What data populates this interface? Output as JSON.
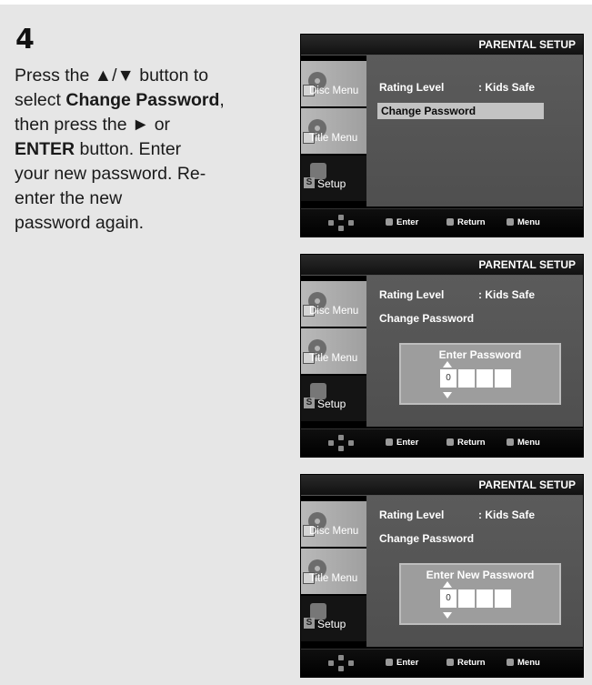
{
  "step": {
    "number": "4",
    "lines": [
      [
        {
          "t": "Press the ▲/▼ button to",
          "b": false
        }
      ],
      [
        {
          "t": "select ",
          "b": false
        },
        {
          "t": "Change Password",
          "b": true
        },
        {
          "t": ",",
          "b": false
        }
      ],
      [
        {
          "t": "then press the ► or",
          "b": false
        }
      ],
      [
        {
          "t": "ENTER",
          "b": true
        },
        {
          "t": " button.        Enter",
          "b": false
        }
      ],
      [
        {
          "t": "your new password. Re-",
          "b": false
        }
      ],
      [
        {
          "t": "enter the new",
          "b": false
        }
      ],
      [
        {
          "t": "password again.",
          "b": false
        }
      ]
    ]
  },
  "screen_title": "PARENTAL SETUP",
  "sidebar": {
    "disc_menu": "Disc Menu",
    "title_menu": "Title Menu",
    "setup": "Setup",
    "setup_badge": "S"
  },
  "menu": {
    "rating_label": "Rating Level",
    "rating_value": ": Kids Safe",
    "change_password": "Change Password"
  },
  "dialogs": {
    "enter_password": "Enter Password",
    "enter_new_password": "Enter New Password",
    "first_digit": "0"
  },
  "footer": {
    "enter": "Enter",
    "return": "Return",
    "menu": "Menu"
  },
  "colors": {
    "page_bg": "#e6e6e6",
    "screen_bg": "#575757",
    "selection_bg": "#c3c3c3",
    "dialog_bg": "#9d9d9d"
  }
}
